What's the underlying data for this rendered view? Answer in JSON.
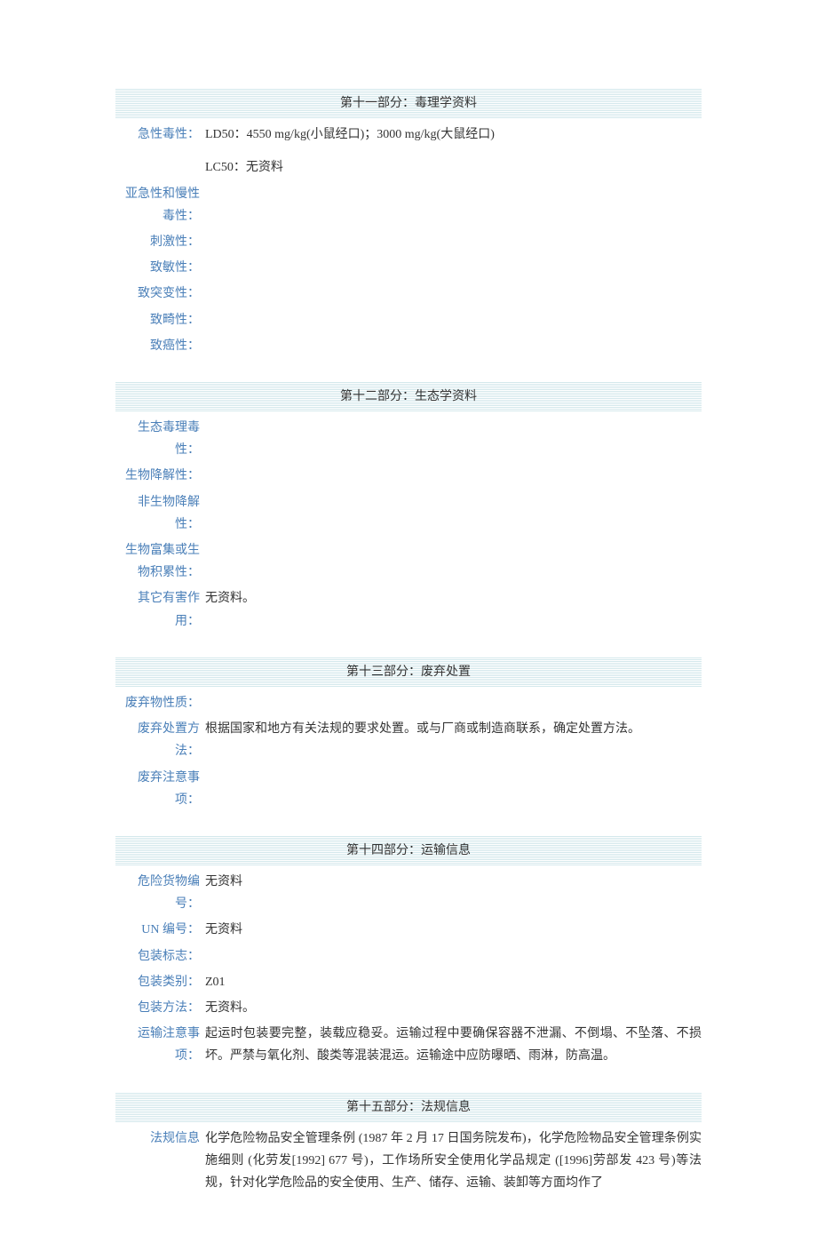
{
  "sections": {
    "s11": {
      "title": "第十一部分：毒理学资料",
      "rows": {
        "acute_toxicity": {
          "label": "急性毒性：",
          "value": "LD50：4550 mg/kg(小鼠经口)；3000 mg/kg(大鼠经口)"
        },
        "lc50": {
          "value": "LC50：无资料"
        },
        "chronic": {
          "label": "亚急性和慢性毒性：",
          "value": ""
        },
        "irritation": {
          "label": "刺激性：",
          "value": ""
        },
        "sensitization": {
          "label": "致敏性：",
          "value": ""
        },
        "mutagenicity": {
          "label": "致突变性：",
          "value": ""
        },
        "teratogenicity": {
          "label": "致畸性：",
          "value": ""
        },
        "carcinogenicity": {
          "label": "致癌性：",
          "value": ""
        }
      }
    },
    "s12": {
      "title": "第十二部分：生态学资料",
      "rows": {
        "ecotoxicity": {
          "label": "生态毒理毒性：",
          "value": ""
        },
        "biodegradability": {
          "label": "生物降解性：",
          "value": ""
        },
        "nonbiodeg": {
          "label": "非生物降解性：",
          "value": ""
        },
        "bioaccum": {
          "label": "生物富集或生物积累性：",
          "value": ""
        },
        "other_harm": {
          "label": "其它有害作用：",
          "value": "无资料。"
        }
      }
    },
    "s13": {
      "title": "第十三部分：废弃处置",
      "rows": {
        "waste_nature": {
          "label": "废弃物性质：",
          "value": ""
        },
        "method": {
          "label": "废弃处置方法：",
          "value": "根据国家和地方有关法规的要求处置。或与厂商或制造商联系，确定处置方法。"
        },
        "precaution": {
          "label": "废弃注意事项：",
          "value": ""
        }
      }
    },
    "s14": {
      "title": "第十四部分：运输信息",
      "rows": {
        "dangerous_no": {
          "label": "危险货物编号：",
          "value": "无资料"
        },
        "un_no": {
          "label": "UN 编号：",
          "value": "无资料"
        },
        "packaging_mark": {
          "label": "包装标志：",
          "value": ""
        },
        "packaging_cat": {
          "label": "包装类别：",
          "value": "Z01"
        },
        "packaging_method": {
          "label": "包装方法：",
          "value": "无资料。"
        },
        "transport_notice": {
          "label": "运输注意事项：",
          "value": "起运时包装要完整，装载应稳妥。运输过程中要确保容器不泄漏、不倒塌、不坠落、不损坏。严禁与氧化剂、酸类等混装混运。运输途中应防曝晒、雨淋，防高温。"
        }
      }
    },
    "s15": {
      "title": "第十五部分：法规信息",
      "rows": {
        "reg_info": {
          "label": "法规信息",
          "value": "化学危险物品安全管理条例 (1987 年 2 月 17 日国务院发布)，化学危险物品安全管理条例实施细则 (化劳发[1992] 677 号)，工作场所安全使用化学品规定 ([1996]劳部发 423 号)等法规，针对化学危险品的安全使用、生产、储存、运输、装卸等方面均作了"
        }
      }
    }
  }
}
